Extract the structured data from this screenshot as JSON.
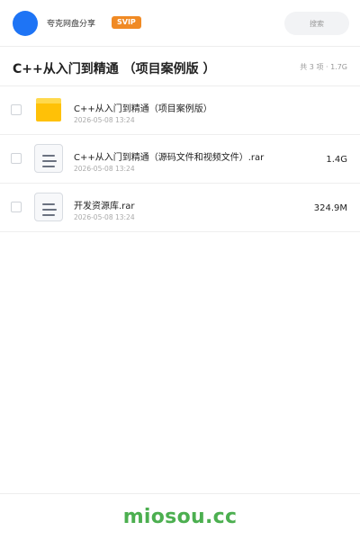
{
  "header": {
    "app_name": "夸克网盘分享",
    "badge": "SVIP",
    "search_placeholder": "搜索"
  },
  "folder": {
    "title": "C++从入门到精通 （项目案例版 ）",
    "summary": "共 3 项 · 1.7G"
  },
  "files": [
    {
      "name": "C++从入门到精通（项目案例版）",
      "date": "2026-05-08 13:24",
      "size": "",
      "icon": "folder-icon"
    },
    {
      "name": "C++从入门到精通（源码文件和视频文件）.rar",
      "date": "2026-05-08 13:24",
      "size": "1.4G",
      "icon": "document-icon"
    },
    {
      "name": "开发资源库.rar",
      "date": "2026-05-08 13:24",
      "size": "324.9M",
      "icon": "document-icon"
    }
  ],
  "footer": {
    "watermark": "miosou.cc"
  },
  "colors": {
    "avatar": "#1e74f5",
    "badge": "#f08a24",
    "folder": "#ffc107",
    "watermark": "#4caf50"
  }
}
